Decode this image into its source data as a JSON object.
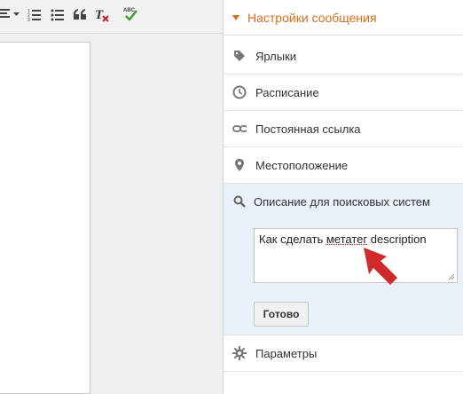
{
  "toolbar": {
    "icons": [
      "align-icon",
      "dropdown-caret-icon",
      "numbered-list-icon",
      "bulleted-list-icon",
      "quote-icon",
      "clear-format-icon",
      "spellcheck-icon"
    ],
    "spellcheck_label": "ABC"
  },
  "sidebar": {
    "header": "Настройки сообщения",
    "items": [
      {
        "label": "Ярлыки",
        "icon": "tag-icon"
      },
      {
        "label": "Расписание",
        "icon": "clock-icon"
      },
      {
        "label": "Постоянная ссылка",
        "icon": "link-icon"
      },
      {
        "label": "Местоположение",
        "icon": "location-pin-icon"
      }
    ],
    "search_description": {
      "label": "Описание для поисковых систем",
      "icon": "search-icon",
      "value_prefix": "Как сделать ",
      "value_word1": "метатег",
      "value_suffix": " description",
      "done_label": "Готово"
    },
    "params": {
      "label": "Параметры",
      "icon": "gear-icon"
    }
  },
  "colors": {
    "accent": "#dd6a17",
    "panel": "#eaf0fa",
    "arrow": "#d12a2a"
  }
}
